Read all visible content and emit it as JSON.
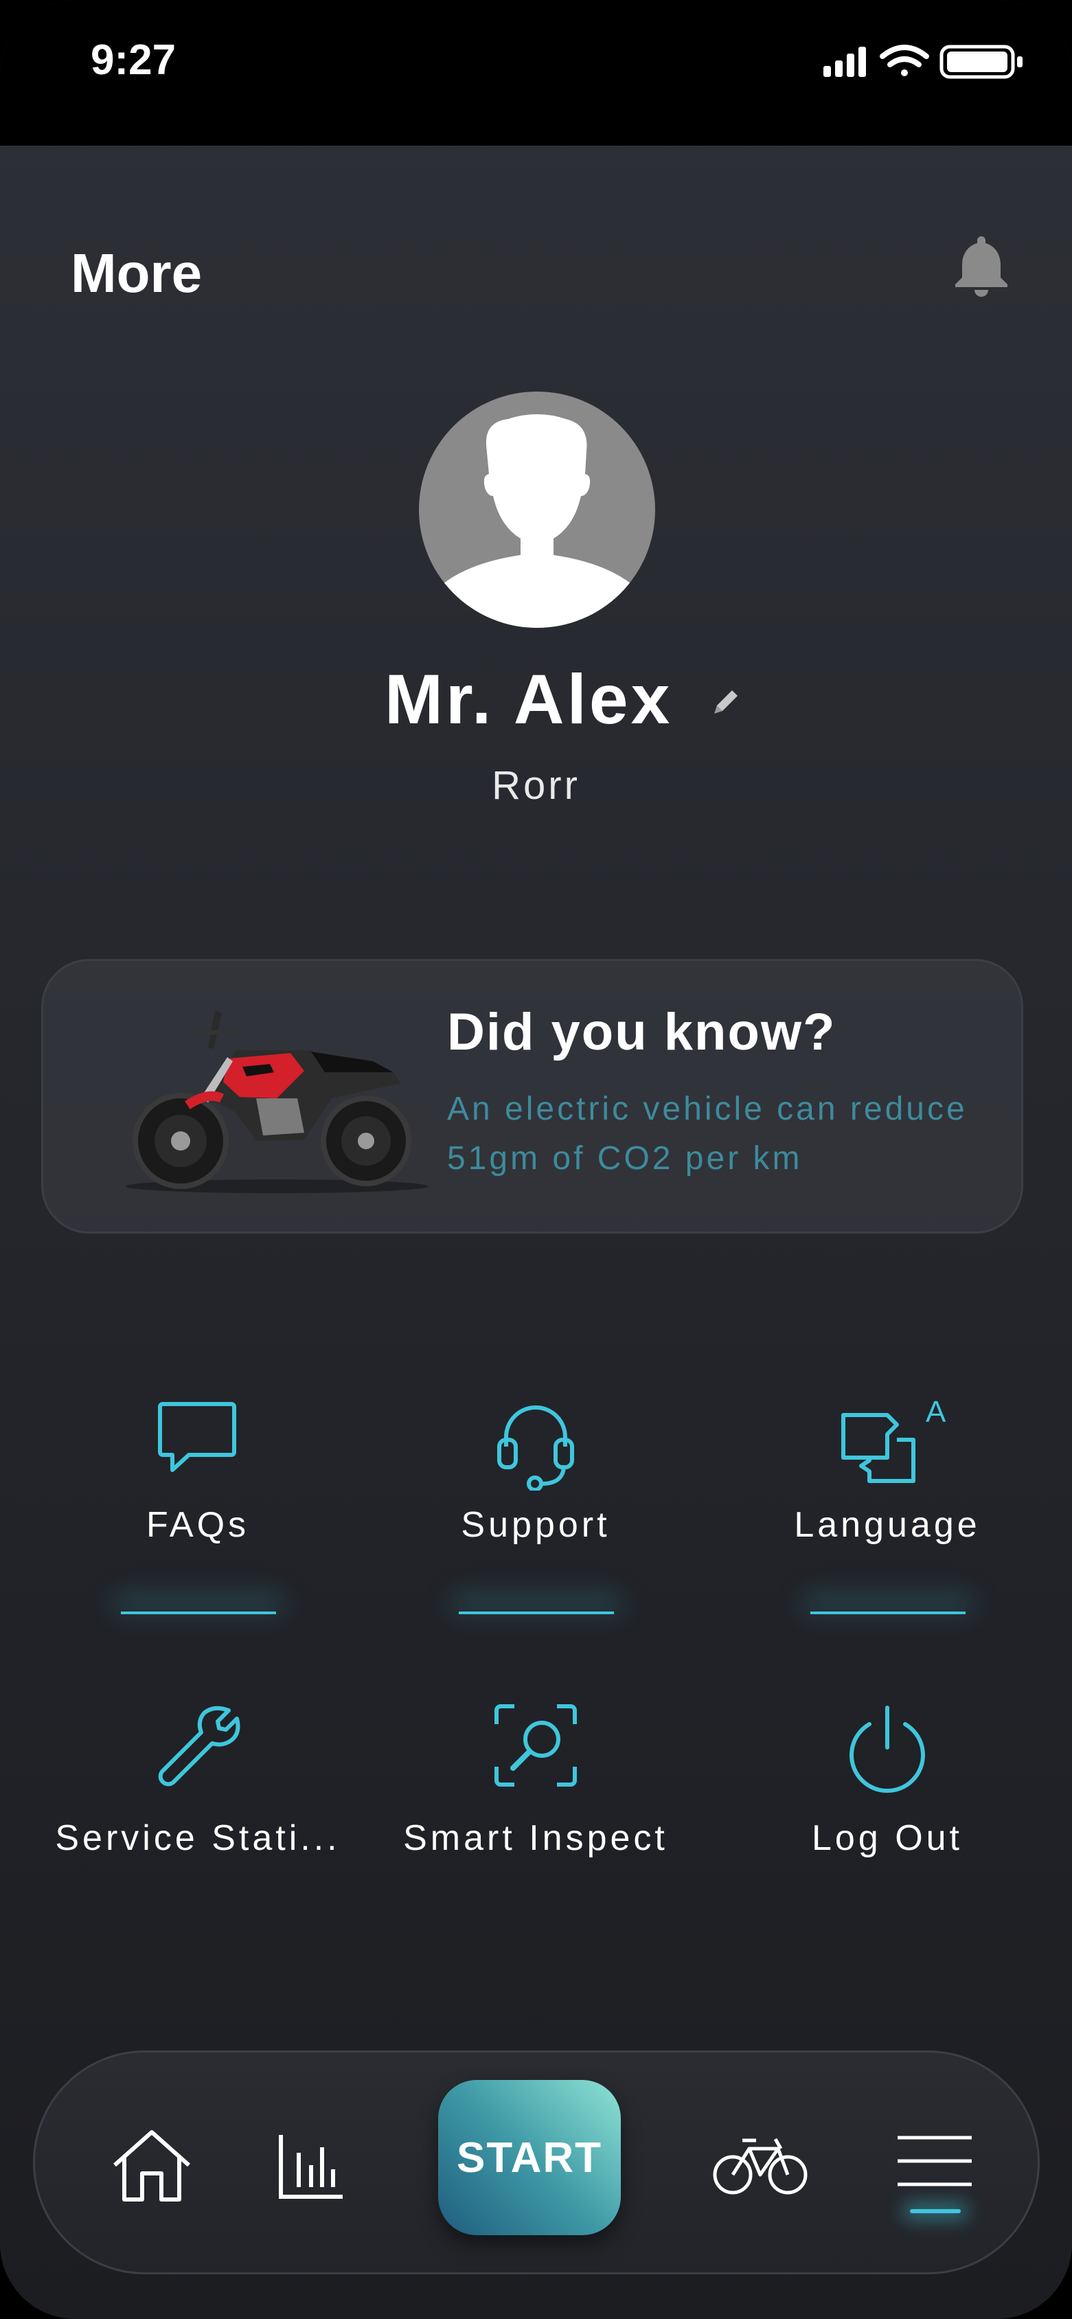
{
  "status_bar": {
    "time": "9:27",
    "icons": [
      "signal-icon",
      "wifi-icon",
      "battery-icon"
    ]
  },
  "header": {
    "title": "More",
    "bell_icon": "bell-icon"
  },
  "profile": {
    "name": "Mr. Alex",
    "subtitle": "Rorr",
    "edit_icon": "pencil-icon"
  },
  "fact_card": {
    "title": "Did you know?",
    "text_line1": "An electric vehicle can reduce",
    "text_line2": "51gm of CO2 per km",
    "image": "electric-motorcycle"
  },
  "actions": [
    {
      "label": "FAQs",
      "icon": "chat-bubble-icon"
    },
    {
      "label": "Support",
      "icon": "headset-icon"
    },
    {
      "label": "Language",
      "icon": "translate-icon"
    },
    {
      "label": "Service Stati...",
      "icon": "wrench-icon"
    },
    {
      "label": "Smart Inspect",
      "icon": "scan-search-icon"
    },
    {
      "label": "Log Out",
      "icon": "power-icon"
    }
  ],
  "bottom_nav": {
    "items": [
      "home-icon",
      "stats-icon",
      "START",
      "bicycle-icon",
      "menu-icon"
    ],
    "start_label": "START",
    "active": "menu"
  },
  "colors": {
    "accent": "#3fc6dc",
    "fact_text": "#3d8b9c",
    "background": "#2a2c32"
  }
}
